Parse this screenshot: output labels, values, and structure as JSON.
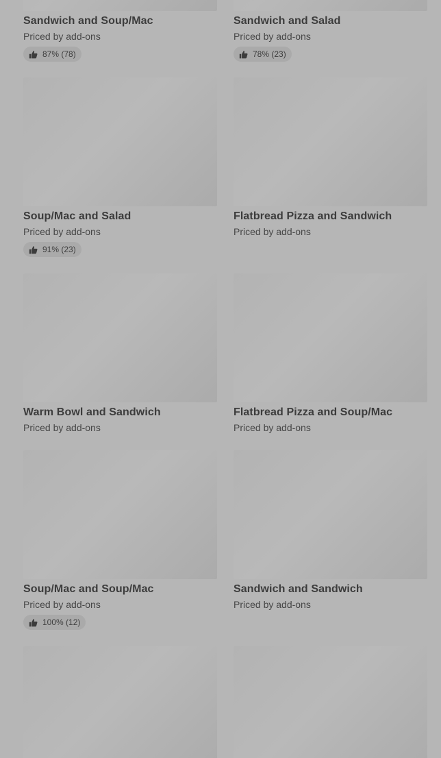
{
  "items": [
    {
      "name": "Sandwich and Soup/Mac",
      "subtitle": "Priced by add-ons",
      "rating": "87% (78)"
    },
    {
      "name": "Sandwich and Salad",
      "subtitle": "Priced by add-ons",
      "rating": "78% (23)"
    },
    {
      "name": "Soup/Mac and Salad",
      "subtitle": "Priced by add-ons",
      "rating": "91% (23)"
    },
    {
      "name": "Flatbread Pizza and Sandwich",
      "subtitle": "Priced by add-ons"
    },
    {
      "name": "Warm Bowl and Sandwich",
      "subtitle": "Priced by add-ons"
    },
    {
      "name": "Flatbread Pizza and Soup/Mac",
      "subtitle": "Priced by add-ons"
    },
    {
      "name": "Soup/Mac and Soup/Mac",
      "subtitle": "Priced by add-ons",
      "rating": "100% (12)"
    },
    {
      "name": "Sandwich and Sandwich",
      "subtitle": "Priced by add-ons"
    }
  ],
  "icons": {
    "rating": "thumbs-up-icon"
  }
}
